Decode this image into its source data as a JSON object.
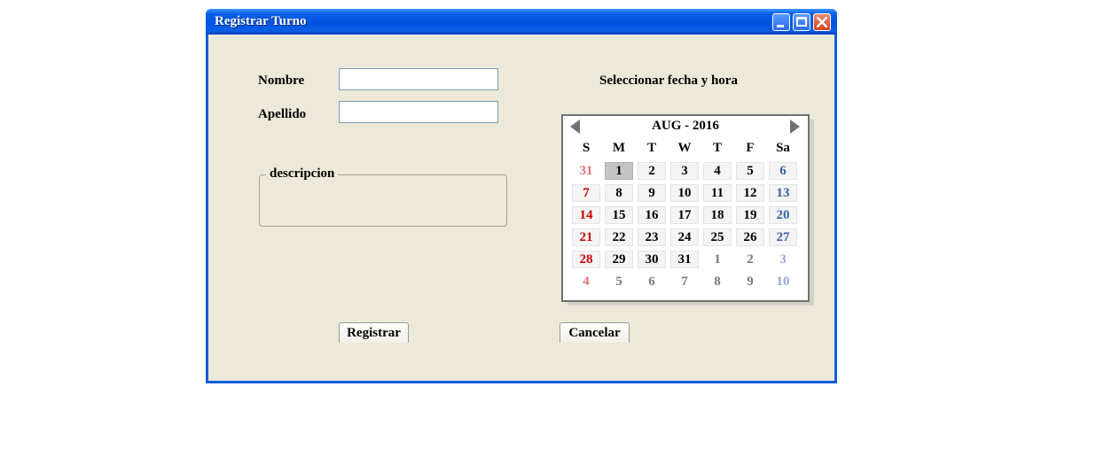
{
  "window": {
    "title": "Registrar Turno"
  },
  "form": {
    "nombre_label": "Nombre",
    "nombre_value": "",
    "apellido_label": "Apellido",
    "apellido_value": "",
    "descripcion_label": "descripcion",
    "fecha_label": "Seleccionar fecha y hora"
  },
  "calendar": {
    "header": "AUG - 2016",
    "weekdays": [
      "S",
      "M",
      "T",
      "W",
      "T",
      "F",
      "Sa"
    ],
    "selected_day": "1",
    "weeks": [
      [
        {
          "d": "31",
          "m": "prev"
        },
        {
          "d": "1",
          "m": "cur"
        },
        {
          "d": "2",
          "m": "cur"
        },
        {
          "d": "3",
          "m": "cur"
        },
        {
          "d": "4",
          "m": "cur"
        },
        {
          "d": "5",
          "m": "cur"
        },
        {
          "d": "6",
          "m": "cur"
        }
      ],
      [
        {
          "d": "7",
          "m": "cur"
        },
        {
          "d": "8",
          "m": "cur"
        },
        {
          "d": "9",
          "m": "cur"
        },
        {
          "d": "10",
          "m": "cur"
        },
        {
          "d": "11",
          "m": "cur"
        },
        {
          "d": "12",
          "m": "cur"
        },
        {
          "d": "13",
          "m": "cur"
        }
      ],
      [
        {
          "d": "14",
          "m": "cur"
        },
        {
          "d": "15",
          "m": "cur"
        },
        {
          "d": "16",
          "m": "cur"
        },
        {
          "d": "17",
          "m": "cur"
        },
        {
          "d": "18",
          "m": "cur"
        },
        {
          "d": "19",
          "m": "cur"
        },
        {
          "d": "20",
          "m": "cur"
        }
      ],
      [
        {
          "d": "21",
          "m": "cur"
        },
        {
          "d": "22",
          "m": "cur"
        },
        {
          "d": "23",
          "m": "cur"
        },
        {
          "d": "24",
          "m": "cur"
        },
        {
          "d": "25",
          "m": "cur"
        },
        {
          "d": "26",
          "m": "cur"
        },
        {
          "d": "27",
          "m": "cur"
        }
      ],
      [
        {
          "d": "28",
          "m": "cur"
        },
        {
          "d": "29",
          "m": "cur"
        },
        {
          "d": "30",
          "m": "cur"
        },
        {
          "d": "31",
          "m": "cur"
        },
        {
          "d": "1",
          "m": "next"
        },
        {
          "d": "2",
          "m": "next"
        },
        {
          "d": "3",
          "m": "next"
        }
      ],
      [
        {
          "d": "4",
          "m": "next"
        },
        {
          "d": "5",
          "m": "next"
        },
        {
          "d": "6",
          "m": "next"
        },
        {
          "d": "7",
          "m": "next"
        },
        {
          "d": "8",
          "m": "next"
        },
        {
          "d": "9",
          "m": "next"
        },
        {
          "d": "10",
          "m": "next"
        }
      ]
    ]
  },
  "buttons": {
    "registrar": "Registrar",
    "cancelar": "Cancelar"
  }
}
